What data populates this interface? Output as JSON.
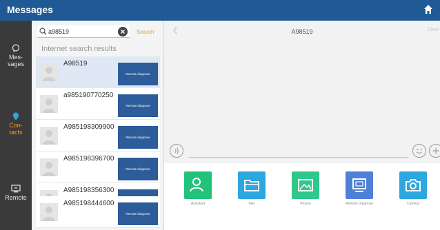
{
  "header": {
    "title": "Messages",
    "home_icon": "home-icon",
    "color": "#1f5a97"
  },
  "nav": {
    "items": [
      {
        "label_line1": "Mes-",
        "label_line2": "sages",
        "icon": "chat-bubble-icon",
        "active": false
      },
      {
        "label_line1": "Con-",
        "label_line2": "tacts",
        "icon": "contact-icon",
        "active": true
      },
      {
        "label_line1": "Remote",
        "label_line2": "",
        "icon": "remote-icon",
        "active": false
      }
    ],
    "active_color": "#f0a020"
  },
  "search": {
    "value": "a98519",
    "button_label": "Search"
  },
  "results": {
    "label": "Internet search results",
    "items": [
      {
        "name": "A98519",
        "action": "Remote diagnose",
        "selected": true
      },
      {
        "name": "a985190770250",
        "action": "Remote diagnose",
        "selected": false
      },
      {
        "name": "A985198309900",
        "action": "Remote diagnose",
        "selected": false
      },
      {
        "name": "A985198396700",
        "action": "Remote diagnose",
        "selected": false
      },
      {
        "name": "A985198356300",
        "action": "Remote diagnose",
        "selected": false
      },
      {
        "name": "A985198444600",
        "action": "Remote diagnose",
        "selected": false
      }
    ]
  },
  "chat": {
    "title": "A98519",
    "right_label": "Clear",
    "back_icon": "chevron-left-icon"
  },
  "tray": {
    "items": [
      {
        "label": "Assistant",
        "icon": "person-icon",
        "color": "#22c27a"
      },
      {
        "label": "File",
        "icon": "folder-icon",
        "color": "#2da7df"
      },
      {
        "label": "Picture",
        "icon": "picture-icon",
        "color": "#2fc78a"
      },
      {
        "label": "Remote Diagnose",
        "icon": "remote-diagnose-icon",
        "color": "#4f80d6"
      },
      {
        "label": "Camera",
        "icon": "camera-icon",
        "color": "#2da7df"
      }
    ]
  }
}
